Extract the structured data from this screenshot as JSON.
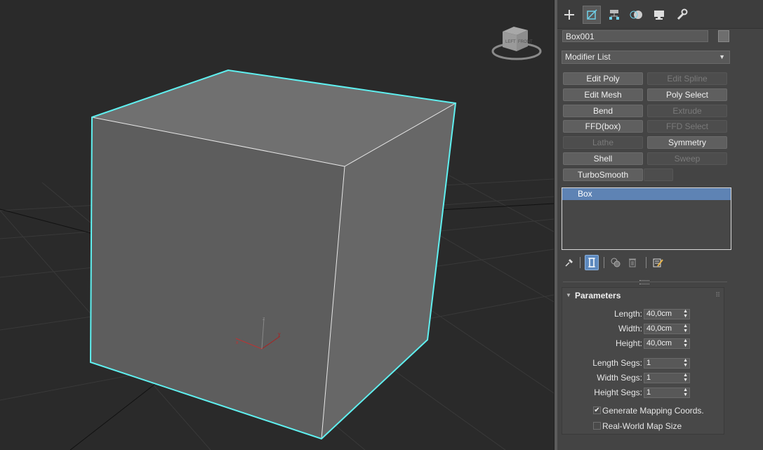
{
  "panel": {
    "tabs": [
      {
        "name": "create-icon",
        "active": false
      },
      {
        "name": "modify-icon",
        "active": true
      },
      {
        "name": "hierarchy-icon",
        "active": false
      },
      {
        "name": "motion-icon",
        "active": false
      },
      {
        "name": "display-icon",
        "active": false
      },
      {
        "name": "utilities-icon",
        "active": false
      }
    ],
    "object_name": "Box001",
    "object_color": "#6e6e6e",
    "modifier_list_label": "Modifier List",
    "modifier_buttons": [
      {
        "label": "Edit Poly",
        "enabled": true
      },
      {
        "label": "Edit Spline",
        "enabled": false
      },
      {
        "label": "Edit Mesh",
        "enabled": true
      },
      {
        "label": "Poly Select",
        "enabled": true
      },
      {
        "label": "Bend",
        "enabled": true
      },
      {
        "label": "Extrude",
        "enabled": false
      },
      {
        "label": "FFD(box)",
        "enabled": true
      },
      {
        "label": "FFD Select",
        "enabled": false
      },
      {
        "label": "Lathe",
        "enabled": false
      },
      {
        "label": "Symmetry",
        "enabled": true
      },
      {
        "label": "Shell",
        "enabled": true
      },
      {
        "label": "Sweep",
        "enabled": false
      },
      {
        "label": "TurboSmooth",
        "enabled": true
      },
      {
        "label": "",
        "enabled": false
      }
    ],
    "stack": [
      {
        "label": "Box",
        "selected": true
      }
    ],
    "parameters": {
      "title": "Parameters",
      "length_label": "Length:",
      "length_value": "40,0cm",
      "width_label": "Width:",
      "width_value": "40,0cm",
      "height_label": "Height:",
      "height_value": "40,0cm",
      "length_segs_label": "Length Segs:",
      "length_segs_value": "1",
      "width_segs_label": "Width Segs:",
      "width_segs_value": "1",
      "height_segs_label": "Height Segs:",
      "height_segs_value": "1",
      "gen_mapping_label": "Generate Mapping Coords.",
      "gen_mapping_checked": true,
      "real_world_label": "Real-World Map Size",
      "real_world_checked": false
    }
  },
  "viewport": {
    "background": "#2a2a2a",
    "selection_color": "#5ff0f0",
    "viewcube_left_label": "LEFT",
    "viewcube_front_label": "FRONT"
  },
  "colors": {
    "selected_row": "#5e83b4",
    "panel_bg": "#444444"
  }
}
